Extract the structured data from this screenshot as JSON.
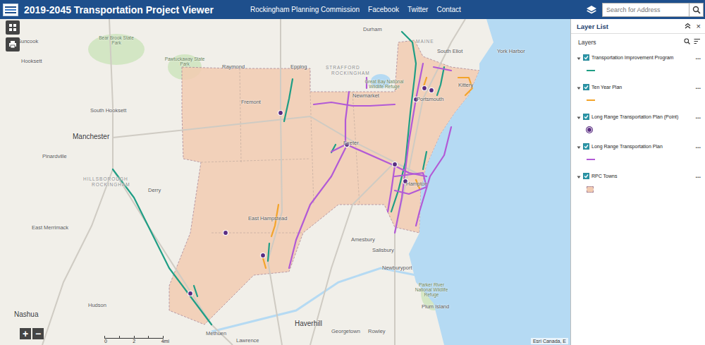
{
  "header": {
    "title": "2019-2045 Transportation Project Viewer",
    "links": [
      "Rockingham Planning Commission",
      "Facebook",
      "Twitter",
      "Contact"
    ],
    "search": {
      "placeholder": "Search for Address"
    }
  },
  "map": {
    "labels": [
      {
        "text": "Suncook",
        "kind": "town"
      },
      {
        "text": "Bear Brook State Park",
        "kind": "park"
      },
      {
        "text": "Pawtuckaway State Park",
        "kind": "park"
      },
      {
        "text": "Hooksett",
        "kind": "town"
      },
      {
        "text": "South Hooksett",
        "kind": "town"
      },
      {
        "text": "Manchester",
        "kind": "city"
      },
      {
        "text": "Pinardville",
        "kind": "town"
      },
      {
        "text": "HILLSBOROUGH",
        "kind": "county"
      },
      {
        "text": "ROCKINGHAM",
        "kind": "county"
      },
      {
        "text": "East Merrimack",
        "kind": "town"
      },
      {
        "text": "Derry",
        "kind": "town"
      },
      {
        "text": "Hudson",
        "kind": "town"
      },
      {
        "text": "Nashua",
        "kind": "city"
      },
      {
        "text": "Methuen",
        "kind": "town"
      },
      {
        "text": "Lawrence",
        "kind": "town"
      },
      {
        "text": "Haverhill",
        "kind": "city"
      },
      {
        "text": "Amesbury",
        "kind": "town"
      },
      {
        "text": "Salisbury",
        "kind": "town"
      },
      {
        "text": "Newburyport",
        "kind": "town"
      },
      {
        "text": "Parker River National Wildlife Refuge",
        "kind": "park"
      },
      {
        "text": "Plum Island",
        "kind": "town"
      },
      {
        "text": "Georgetown",
        "kind": "town"
      },
      {
        "text": "Rowley",
        "kind": "town"
      },
      {
        "text": "Raymond",
        "kind": "town"
      },
      {
        "text": "Epping",
        "kind": "town"
      },
      {
        "text": "Fremont",
        "kind": "town"
      },
      {
        "text": "Exeter",
        "kind": "town"
      },
      {
        "text": "STRAFFORD",
        "kind": "county"
      },
      {
        "text": "ROCKINGHAM",
        "kind": "county"
      },
      {
        "text": "Newmarket",
        "kind": "town"
      },
      {
        "text": "Durham",
        "kind": "town"
      },
      {
        "text": "Great Bay National Wildlife Refuge",
        "kind": "park"
      },
      {
        "text": "MAINE",
        "kind": "county"
      },
      {
        "text": "South Eliot",
        "kind": "town"
      },
      {
        "text": "York Harbor",
        "kind": "town"
      },
      {
        "text": "Kittery",
        "kind": "town"
      },
      {
        "text": "Portsmouth",
        "kind": "town"
      },
      {
        "text": "Hampton",
        "kind": "town"
      },
      {
        "text": "East Hampstead",
        "kind": "town"
      }
    ],
    "zoom": {
      "in": "+",
      "out": "−"
    },
    "scale": {
      "ticks": [
        "0",
        "2",
        "4mi"
      ]
    },
    "attribution": "Esri Canada, E"
  },
  "layer_list": {
    "title": "Layer List",
    "close": "×",
    "subtitle": "Layers",
    "layers": [
      {
        "label": "Transportation Improvement Program",
        "checked": true,
        "color": "#1f9e85",
        "kind": "line",
        "menu": "..."
      },
      {
        "label": "Ten Year Plan",
        "checked": true,
        "color": "#f3a42a",
        "kind": "line",
        "menu": "..."
      },
      {
        "label": "Long Range Transportation Plan (Point)",
        "checked": true,
        "color": "#5a2d82",
        "kind": "point",
        "menu": "..."
      },
      {
        "label": "Long Range Transportation Plan",
        "checked": true,
        "color": "#b25ad6",
        "kind": "line",
        "menu": "..."
      },
      {
        "label": "RPC Towns",
        "checked": true,
        "color": "#f2cbb2",
        "kind": "fill",
        "menu": "..."
      }
    ]
  }
}
